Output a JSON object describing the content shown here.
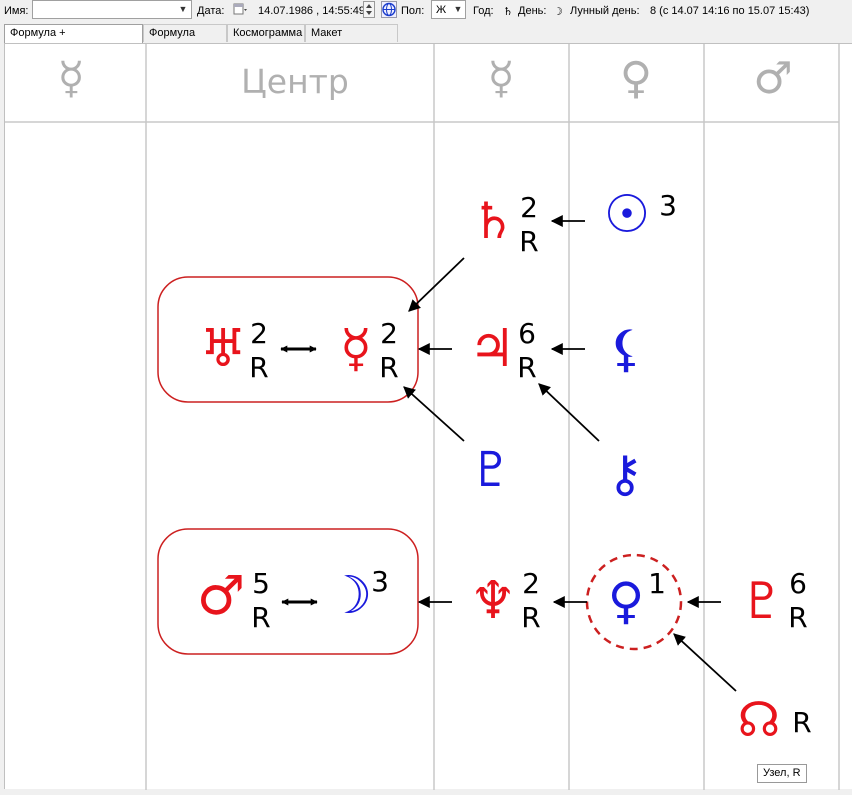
{
  "toolbar": {
    "name_label": "Имя:",
    "name_value": "",
    "date_label": "Дата:",
    "date_value": "14.07.1986 , 14:55:49",
    "sex_label": "Пол:",
    "sex_value": "Ж",
    "year_label": "Год:",
    "year_symbol": "♄",
    "day_label": "День:",
    "day_symbol": "☽",
    "lunar_day_label": "Лунный день:",
    "lunar_day_value": "8 (с 14.07 14:16 по 15.07 15:43)"
  },
  "tabs": [
    {
      "label": "Формула + Космограмма",
      "active": true
    },
    {
      "label": "Формула Души",
      "active": false
    },
    {
      "label": "Космограмма",
      "active": false
    },
    {
      "label": "Макет страницы",
      "active": false
    }
  ],
  "header": {
    "col1": "☿",
    "col2": "Центр",
    "col3": "☿",
    "col4": "♀",
    "col5": "♂"
  },
  "formula": {
    "saturn": {
      "symbol": "♄",
      "num": "2",
      "r": "R"
    },
    "sun": {
      "symbol": "☉",
      "num": "3"
    },
    "uranus": {
      "symbol": "♅",
      "num": "2",
      "r": "R"
    },
    "mercury": {
      "symbol": "☿",
      "num": "2",
      "r": "R"
    },
    "jupiter": {
      "symbol": "♃",
      "num": "6",
      "r": "R"
    },
    "lilith": {
      "symbol": "⚸"
    },
    "proserpina": {
      "symbol": "♇"
    },
    "chiron": {
      "symbol": "⚷"
    },
    "mars": {
      "symbol": "♂",
      "num": "5",
      "r": "R"
    },
    "moon": {
      "symbol": "☽",
      "num": "3"
    },
    "neptune": {
      "symbol": "♆",
      "num": "2",
      "r": "R"
    },
    "venus": {
      "symbol": "♀",
      "num": "1"
    },
    "pluto": {
      "symbol": "♇",
      "num": "6",
      "r": "R"
    },
    "node": {
      "symbol": "☊",
      "r": "R"
    },
    "bidir_arrow": "↔"
  },
  "tooltip": "Узел, R",
  "colors": {
    "red": "#e8141c",
    "blue": "#1a1adc",
    "grid": "#c8c8c8",
    "header": "#b0b0b0"
  }
}
